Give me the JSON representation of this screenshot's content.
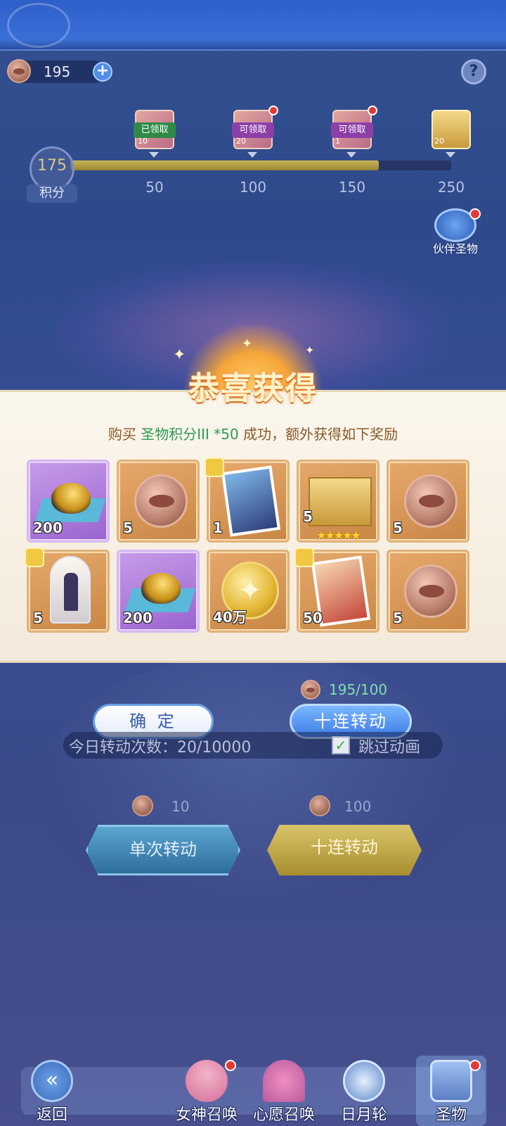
{
  "currency": {
    "amount": "195"
  },
  "score": {
    "value": "175",
    "label": "积分",
    "progress_fraction": 0.81
  },
  "milestones": [
    {
      "label": "50",
      "status": "已领取",
      "qty": "10"
    },
    {
      "label": "100",
      "status": "可领取",
      "qty": "20"
    },
    {
      "label": "150",
      "status": "可领取",
      "qty": "1"
    },
    {
      "label": "250",
      "status": "",
      "qty": "20"
    }
  ],
  "partner_relic": {
    "label": "伙伴圣物"
  },
  "popup": {
    "title": "恭喜获得",
    "msg_prefix": "购买",
    "msg_item": "圣物积分III *50",
    "msg_suffix": "成功，额外获得如下奖励",
    "rewards": [
      {
        "icon": "gold-stone-icon",
        "qty": "200"
      },
      {
        "icon": "lip-coin-icon",
        "qty": "5"
      },
      {
        "icon": "character-card-icon",
        "qty": "1"
      },
      {
        "icon": "card-box-icon",
        "qty": "5",
        "stars": "★★★★★"
      },
      {
        "icon": "lip-coin-icon",
        "qty": "5"
      },
      {
        "icon": "figure-dome-icon",
        "qty": "5"
      },
      {
        "icon": "gold-stone-icon",
        "qty": "200"
      },
      {
        "icon": "gold-coin-icon",
        "qty": "40万"
      },
      {
        "icon": "character-card-icon",
        "qty": "50"
      },
      {
        "icon": "lip-coin-icon",
        "qty": "5"
      }
    ]
  },
  "rate": "195/100",
  "buttons": {
    "confirm": "确 定",
    "ten_spin": "十连转动"
  },
  "today": {
    "text": "今日转动次数：20/10000",
    "skip": "跳过动画"
  },
  "spin": {
    "single_cost": "10",
    "ten_cost": "100",
    "single_label": "单次转动",
    "ten_label": "十连转动"
  },
  "nav": [
    {
      "label": "返回"
    },
    {
      "label": "女神召唤"
    },
    {
      "label": "心愿召唤"
    },
    {
      "label": "日月轮"
    },
    {
      "label": "圣物"
    }
  ]
}
